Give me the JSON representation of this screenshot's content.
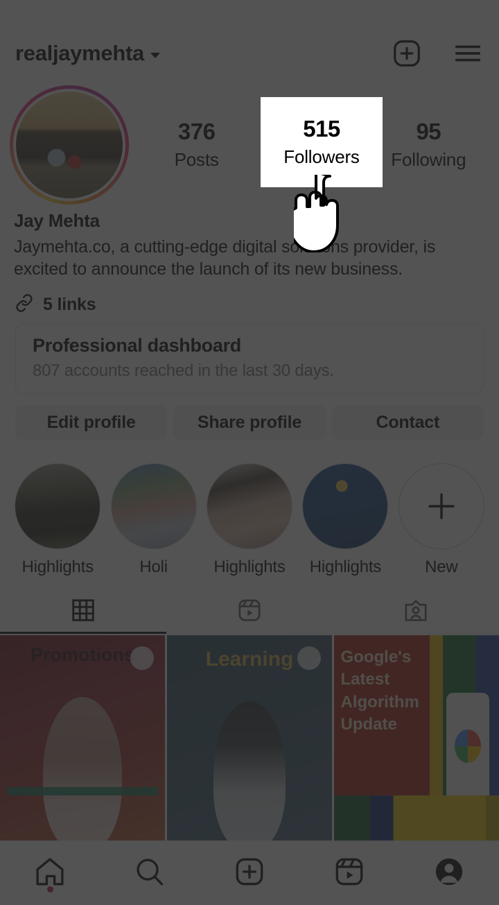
{
  "app": {
    "name": "Instagram",
    "screen": "profile"
  },
  "header": {
    "username": "realjaymehta",
    "chevron_icon": "chevron-down-icon",
    "create_icon": "plus-square-icon",
    "menu_icon": "hamburger-menu-icon"
  },
  "profile": {
    "avatar": {
      "has_story_ring": true,
      "ring_colors": [
        "#f9ce34",
        "#ee2a7b",
        "#b32fa0",
        "#f58529"
      ]
    },
    "stats": [
      {
        "key": "posts",
        "value": "376",
        "label": "Posts"
      },
      {
        "key": "followers",
        "value": "515",
        "label": "Followers"
      },
      {
        "key": "following",
        "value": "95",
        "label": "Following"
      }
    ],
    "display_name": "Jay Mehta",
    "bio": "Jaymehta.co, a cutting-edge digital solutions provider, is excited to announce the launch of its new business.",
    "links": {
      "icon": "link-icon",
      "label": "5 links"
    }
  },
  "dashboard": {
    "title": "Professional dashboard",
    "subtitle": "807 accounts reached in the last 30 days."
  },
  "actions": [
    {
      "key": "edit",
      "label": "Edit profile"
    },
    {
      "key": "share",
      "label": "Share profile"
    },
    {
      "key": "contact",
      "label": "Contact"
    }
  ],
  "highlights": [
    {
      "label": "Highlights",
      "icon": "story-highlight-thumb"
    },
    {
      "label": "Holi",
      "icon": "story-highlight-thumb"
    },
    {
      "label": "Highlights",
      "icon": "story-highlight-thumb"
    },
    {
      "label": "Highlights",
      "icon": "story-highlight-thumb"
    },
    {
      "label": "New",
      "icon": "plus-icon"
    }
  ],
  "tabs": [
    {
      "key": "grid",
      "icon": "grid-icon",
      "active": true
    },
    {
      "key": "reels",
      "icon": "reels-icon",
      "active": false
    },
    {
      "key": "tagged",
      "icon": "tagged-icon",
      "active": false
    }
  ],
  "grid_posts": [
    {
      "caption": "Promotions",
      "badge": "carousel-icon",
      "bg": "#8e2434"
    },
    {
      "caption": "Learning",
      "badge": "carousel-icon",
      "bg": "#37566b"
    },
    {
      "caption": "Google's Latest Algorithm Update",
      "badge": "",
      "bg": "#a81f18"
    }
  ],
  "bottom_nav": [
    {
      "key": "home",
      "icon": "home-icon",
      "badge": true,
      "active": false
    },
    {
      "key": "search",
      "icon": "search-icon",
      "badge": false,
      "active": false
    },
    {
      "key": "create",
      "icon": "plus-square-icon",
      "badge": false,
      "active": false
    },
    {
      "key": "reels",
      "icon": "reels-icon",
      "badge": false,
      "active": false
    },
    {
      "key": "profile",
      "icon": "profile-avatar-icon",
      "badge": false,
      "active": true
    }
  ],
  "overlay": {
    "spotlight_target": "followers-stat",
    "spotlight_number": "515",
    "spotlight_label": "Followers",
    "cursor_icon": "pointing-hand-cursor",
    "dim_color": "#434343"
  }
}
